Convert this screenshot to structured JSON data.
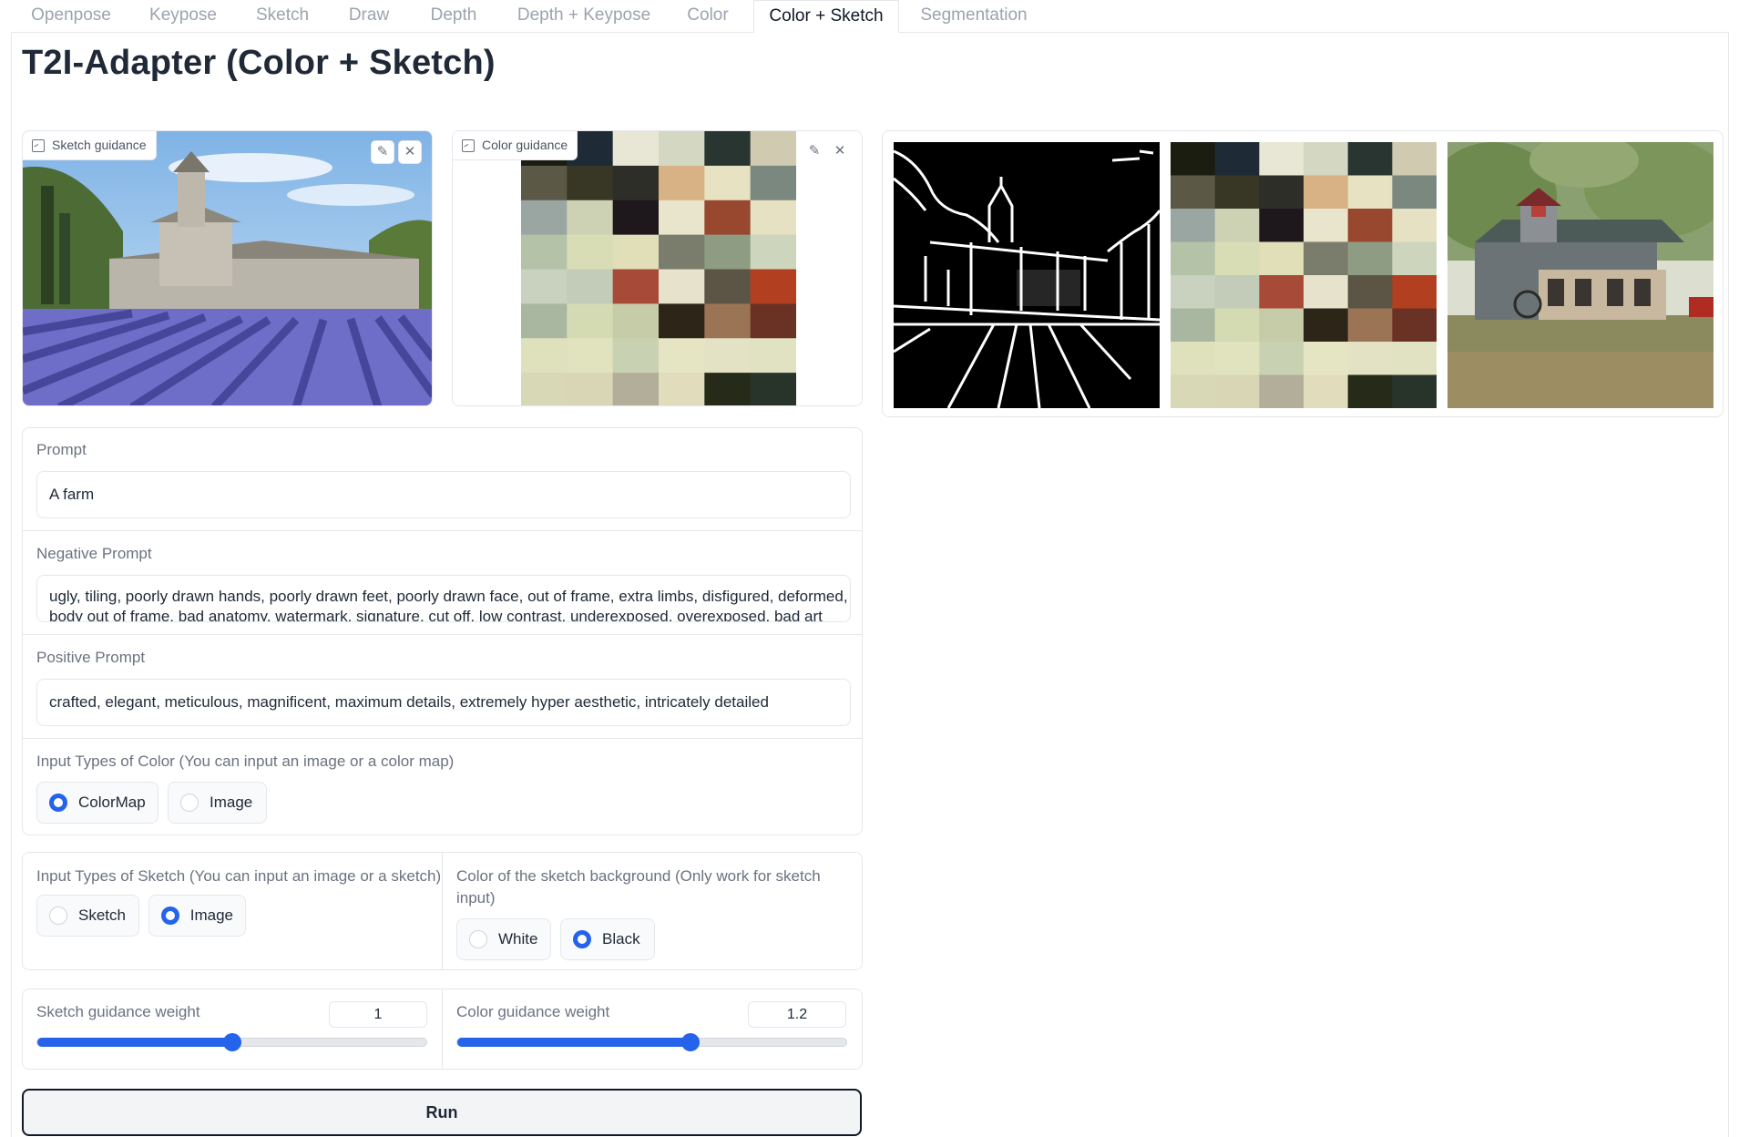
{
  "tabs": [
    {
      "label": "Openpose"
    },
    {
      "label": "Keypose"
    },
    {
      "label": "Sketch"
    },
    {
      "label": "Draw"
    },
    {
      "label": "Depth"
    },
    {
      "label": "Depth + Keypose"
    },
    {
      "label": "Color"
    },
    {
      "label": "Color + Sketch",
      "active": true
    },
    {
      "label": "Segmentation"
    }
  ],
  "page": {
    "title": "T2I-Adapter (Color + Sketch)"
  },
  "inputs": {
    "sketch_label": "Sketch guidance",
    "color_label": "Color guidance",
    "edit_icon": "pencil-icon",
    "clear_icon": "close-icon"
  },
  "color_map": {
    "grid": [
      [
        "#1a1d10",
        "#1e2a36",
        "#e8e6d4",
        "#d4d8c2",
        "#283530",
        "#cfcab0"
      ],
      [
        "#5c5846",
        "#383625",
        "#2e2e28",
        "#d8b184",
        "#e6e2c2",
        "#7a8880"
      ],
      [
        "#9aa6a2",
        "#ced2b5",
        "#1e171c",
        "#e9e5cc",
        "#98482e",
        "#e6e1c2"
      ],
      [
        "#b4c2a8",
        "#d8ddb6",
        "#e0dfb8",
        "#7a7c6c",
        "#8e9c84",
        "#cdd6bc"
      ],
      [
        "#c8d2be",
        "#c2ccb8",
        "#a84a38",
        "#e6e2cc",
        "#5c5444",
        "#b24020"
      ],
      [
        "#aab7a0",
        "#d4dab2",
        "#c6cba8",
        "#2d2518",
        "#9a7454",
        "#6a3224"
      ],
      [
        "#dfe0bc",
        "#e1e2be",
        "#c8d2b2",
        "#e5e5c4",
        "#e4e2c4",
        "#e0e2c2"
      ],
      [
        "#d8d8b6",
        "#d8d6b4",
        "#b2ae9a",
        "#e0dcbc",
        "#262a18",
        "#28342a"
      ]
    ]
  },
  "form": {
    "prompt": {
      "label": "Prompt",
      "value": "A farm"
    },
    "negative_prompt": {
      "label": "Negative Prompt",
      "line1": "ugly, tiling, poorly drawn hands, poorly drawn feet, poorly drawn face, out of frame, extra limbs, disfigured, deformed,",
      "line2": "body out of frame, bad anatomy, watermark, signature, cut off, low contrast, underexposed, overexposed, bad art"
    },
    "positive_prompt": {
      "label": "Positive Prompt",
      "value": "crafted, elegant, meticulous, magnificent, maximum details, extremely hyper aesthetic, intricately detailed"
    },
    "color_type": {
      "label": "Input Types of Color (You can input an image or a color map)",
      "options": [
        "ColorMap",
        "Image"
      ],
      "selected": "ColorMap"
    },
    "sketch_type": {
      "label": "Input Types of Sketch (You can input an image or a sketch)",
      "options": [
        "Sketch",
        "Image"
      ],
      "selected": "Image"
    },
    "sketch_bg": {
      "label_line1": "Color of the sketch background (Only work for sketch",
      "label_line2": "input)",
      "options": [
        "White",
        "Black"
      ],
      "selected": "Black"
    },
    "sketch_weight": {
      "label": "Sketch guidance weight",
      "value": "1",
      "fraction": 0.5
    },
    "color_weight": {
      "label": "Color guidance weight",
      "value": "1.2",
      "fraction": 0.6
    },
    "run_label": "Run"
  }
}
